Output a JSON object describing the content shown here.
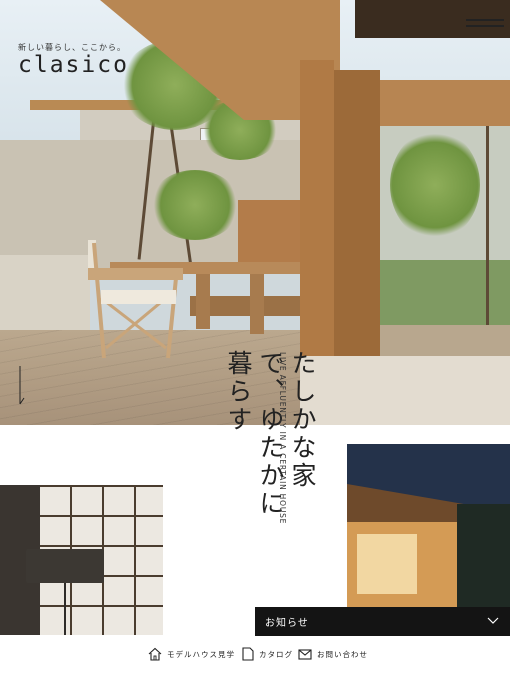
{
  "brand": {
    "tagline": "新しい暮らし、ここから。",
    "logo": "clasico"
  },
  "hero": {
    "catch_copy": "たしかな家で、ゆたかに暮らす",
    "catch_copy_en": "LIVE AFFLUENTLY IN A CERTAIN HOUSE"
  },
  "news_bar": {
    "label": "お知らせ"
  },
  "footer_nav": [
    {
      "label": "モデルハウス見学",
      "icon": "house-icon"
    },
    {
      "label": "カタログ",
      "icon": "document-icon"
    },
    {
      "label": "お問い合わせ",
      "icon": "mail-icon"
    }
  ],
  "icons": {
    "menu": "hamburger-menu-icon",
    "scroll": "down-arrow-icon",
    "news_toggle": "chevron-down-icon"
  },
  "colors": {
    "news_bar_bg": "#141414",
    "text": "#222222"
  }
}
